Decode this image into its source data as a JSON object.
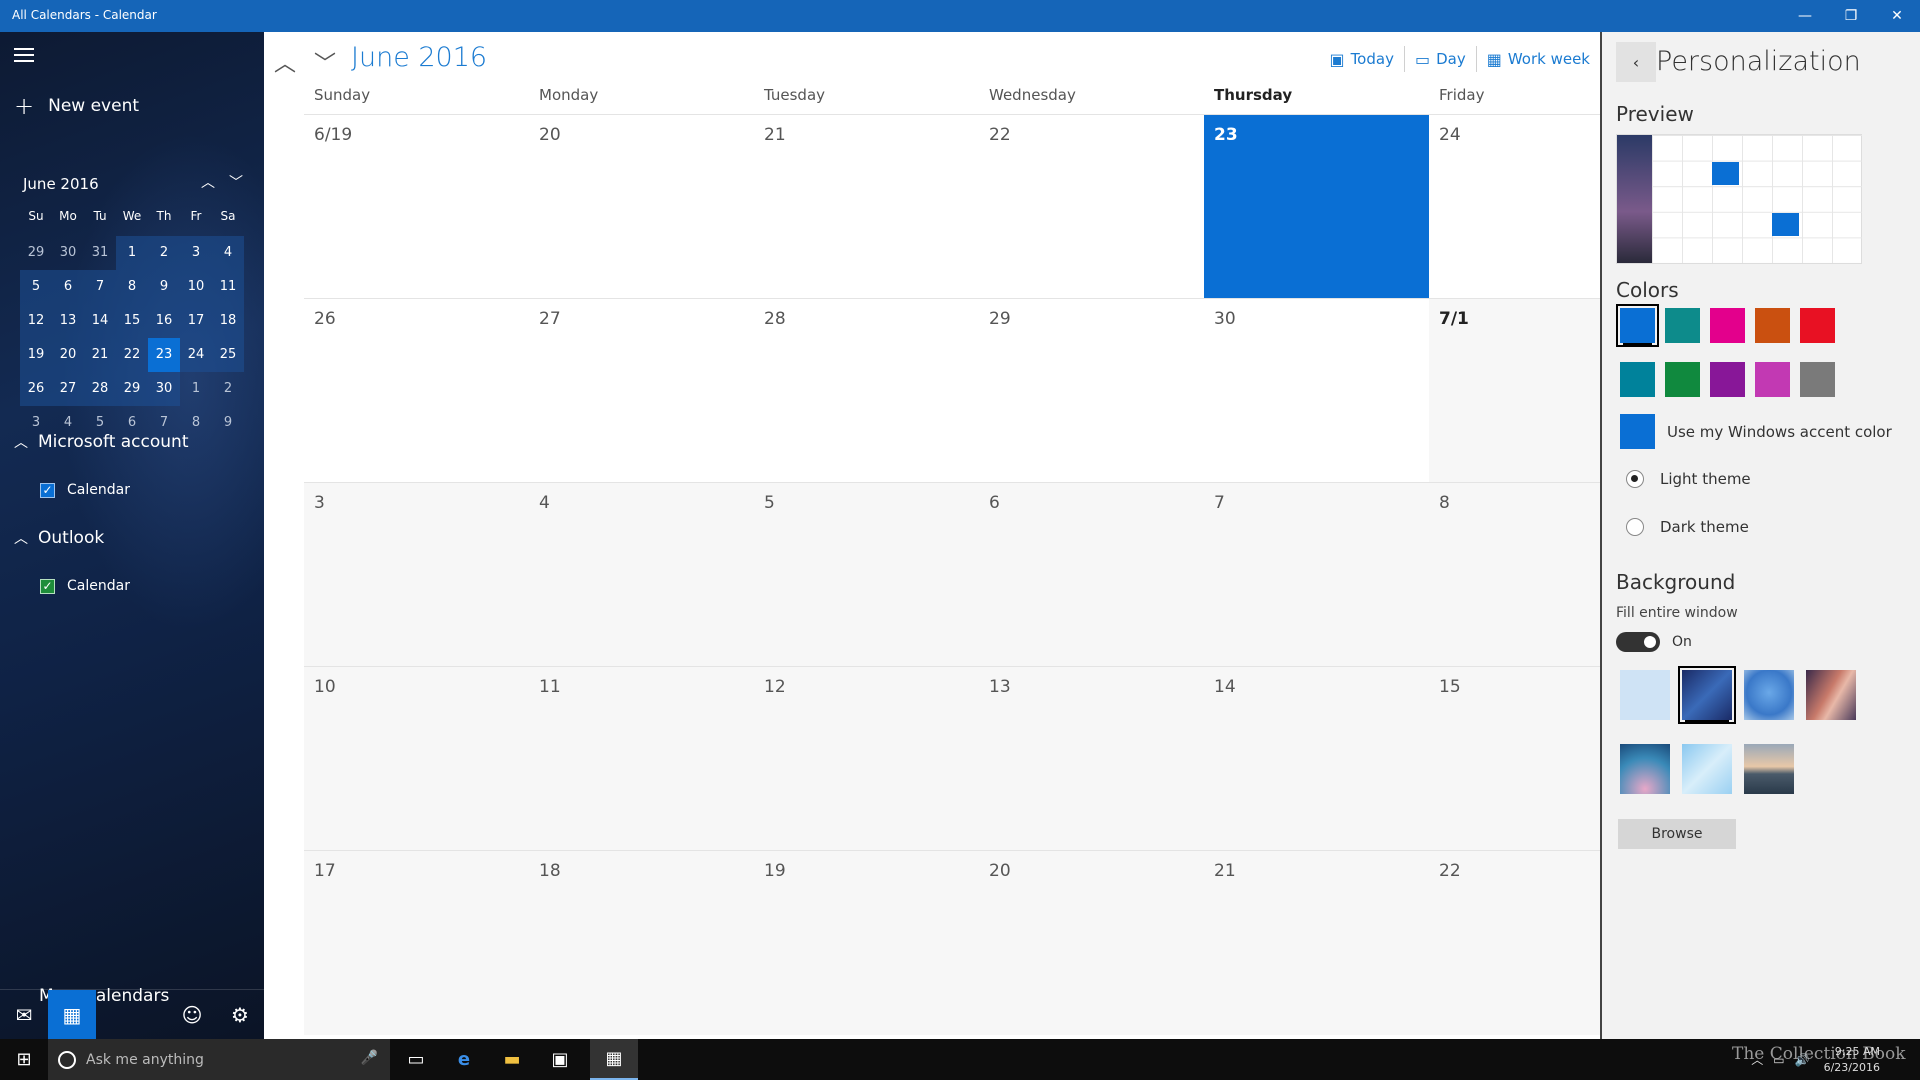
{
  "window": {
    "title": "All Calendars - Calendar",
    "controls": {
      "minimize": "—",
      "restore": "❐",
      "close": "✕"
    }
  },
  "sidebar": {
    "new_event": "New event",
    "mini_cal": {
      "title": "June 2016",
      "dow": [
        "Su",
        "Mo",
        "Tu",
        "We",
        "Th",
        "Fr",
        "Sa"
      ],
      "weeks": [
        [
          "29",
          "30",
          "31",
          "1",
          "2",
          "3",
          "4"
        ],
        [
          "5",
          "6",
          "7",
          "8",
          "9",
          "10",
          "11"
        ],
        [
          "12",
          "13",
          "14",
          "15",
          "16",
          "17",
          "18"
        ],
        [
          "19",
          "20",
          "21",
          "22",
          "23",
          "24",
          "25"
        ],
        [
          "26",
          "27",
          "28",
          "29",
          "30",
          "1",
          "2"
        ],
        [
          "3",
          "4",
          "5",
          "6",
          "7",
          "8",
          "9"
        ]
      ],
      "today": "23"
    },
    "accounts": [
      {
        "name": "Microsoft account",
        "calendar": "Calendar",
        "color": "#0a6fd4"
      },
      {
        "name": "Outlook",
        "calendar": "Calendar",
        "color": "#1e8d3a"
      }
    ],
    "more_calendars": "More calendars"
  },
  "main": {
    "month_title": "June 2016",
    "views": [
      {
        "icon": "today-icon",
        "label": "Today"
      },
      {
        "icon": "day-icon",
        "label": "Day"
      },
      {
        "icon": "work-week-icon",
        "label": "Work week"
      }
    ],
    "dow": [
      "Sunday",
      "Monday",
      "Tuesday",
      "Wednesday",
      "Thursday",
      "Friday"
    ],
    "today_dow_index": 4,
    "weeks": [
      [
        "6/19",
        "20",
        "21",
        "22",
        "23",
        "24"
      ],
      [
        "26",
        "27",
        "28",
        "29",
        "30",
        "7/1"
      ],
      [
        "3",
        "4",
        "5",
        "6",
        "7",
        "8"
      ],
      [
        "10",
        "11",
        "12",
        "13",
        "14",
        "15"
      ],
      [
        "17",
        "18",
        "19",
        "20",
        "21",
        "22"
      ]
    ]
  },
  "panel": {
    "title": "Personalization",
    "preview_label": "Preview",
    "colors_label": "Colors",
    "colors_row1": [
      "#0a6fd4",
      "#0d8b8b",
      "#e3008c",
      "#ca5010",
      "#e81123"
    ],
    "colors_row2": [
      "#00829b",
      "#10893e",
      "#881798",
      "#c239b3",
      "#7a7a7a"
    ],
    "accent_color": "#0a6fd4",
    "accent_label": "Use my Windows accent color",
    "light_theme": "Light theme",
    "dark_theme": "Dark theme",
    "background_label": "Background",
    "fill_label": "Fill entire window",
    "toggle_state": "On",
    "browse": "Browse"
  },
  "taskbar": {
    "search_placeholder": "Ask me anything",
    "time": "9:25 AM",
    "date": "6/23/2016",
    "watermark": "The Collection Book"
  }
}
